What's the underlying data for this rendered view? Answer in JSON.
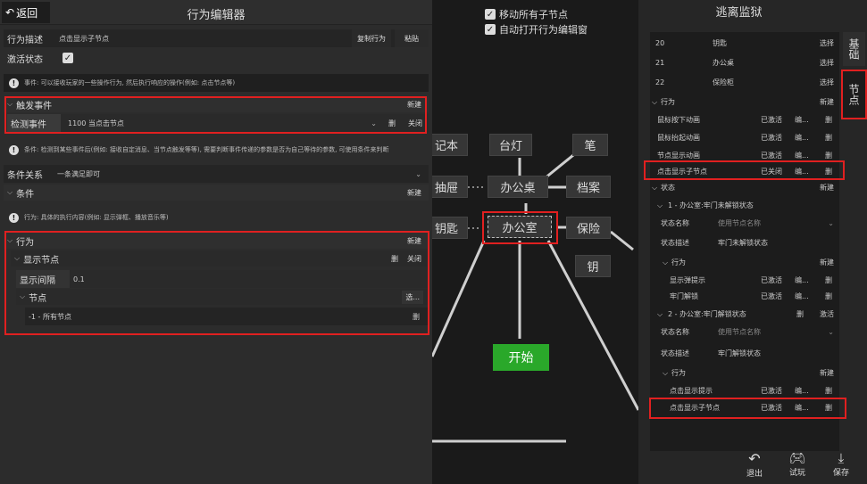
{
  "editor": {
    "back_label": "返回",
    "title": "行为编辑器",
    "desc_label": "行为描述",
    "desc_value": "点击显示子节点",
    "copy_btn": "复制行为",
    "paste_btn": "粘贴",
    "active_label": "激活状态",
    "active_check": "✓",
    "event_note": "事件: 可以接收玩家的一些操作行为, 然后执行响应的操作(例如: 点击节点等)",
    "trigger_header": "触发事件",
    "new_btn": "新建",
    "detect_label": "检测事件",
    "detect_value": "1100 当点击节点",
    "delete_btn": "删",
    "close_btn": "关闭",
    "cond_note": "条件: 检测到某些事件后(例如: 接收自定消息、当节点触发等等), 需要判断事件传递的参数是否为自己等待的参数, 可使用条件来判断",
    "cond_rel_label": "条件关系",
    "cond_rel_value": "一条满足即可",
    "cond_header": "条件",
    "action_note": "行为: 具体的执行内容(例如: 显示弹框、播放音乐等)",
    "action_header": "行为",
    "show_node_header": "显示节点",
    "interval_label": "显示间隔",
    "interval_value": "0.1",
    "node_label": "节点",
    "select_btn": "选...",
    "node_value": "-1 - 所有节点"
  },
  "graph": {
    "move_children": "移动所有子节点",
    "auto_open": "自动打开行为编辑窗",
    "check": "✓",
    "nodes": [
      "记本",
      "台灯",
      "笔",
      "抽屉",
      "办公桌",
      "档案",
      "钥匙",
      "办公室",
      "保险",
      "钥",
      "开始"
    ]
  },
  "panel": {
    "title": "逃离监狱",
    "items": [
      {
        "num": "20",
        "name": "钥匙",
        "act": "选择"
      },
      {
        "num": "21",
        "name": "办公桌",
        "act": "选择"
      },
      {
        "num": "22",
        "name": "保险柜",
        "act": "选择"
      }
    ],
    "behavior_header": "行为",
    "new": "新建",
    "behaviors": [
      {
        "name": "鼠标按下动画",
        "state": "已激活",
        "edit": "编...",
        "del": "删"
      },
      {
        "name": "鼠标抬起动画",
        "state": "已激活",
        "edit": "编...",
        "del": "删"
      },
      {
        "name": "节点显示动画",
        "state": "已激活",
        "edit": "编...",
        "del": "删"
      },
      {
        "name": "点击显示子节点",
        "state": "已关闭",
        "edit": "编...",
        "del": "删"
      }
    ],
    "state_header": "状态",
    "state1": "1 - 办公室:牢门未解锁状态",
    "state_name_label": "状态名称",
    "state_name_ph": "使用节点名称",
    "state_desc_label": "状态描述",
    "state1_desc": "牢门未解锁状态",
    "s1_actions": [
      {
        "name": "显示弹提示",
        "state": "已激活",
        "edit": "编...",
        "del": "删"
      },
      {
        "name": "牢门解锁",
        "state": "已激活",
        "edit": "编...",
        "del": "删"
      }
    ],
    "state2": "2 - 办公室:牢门解锁状态",
    "s2_del": "删",
    "s2_active": "激活",
    "state2_desc": "牢门解锁状态",
    "s2_actions": [
      {
        "name": "点击显示提示",
        "state": "已激活",
        "edit": "编...",
        "del": "删"
      },
      {
        "name": "点击显示子节点",
        "state": "已激活",
        "edit": "编...",
        "del": "删"
      }
    ],
    "tab_basic": "基础",
    "tab_node": "节点",
    "exit": "退出",
    "test": "试玩",
    "save": "保存"
  }
}
